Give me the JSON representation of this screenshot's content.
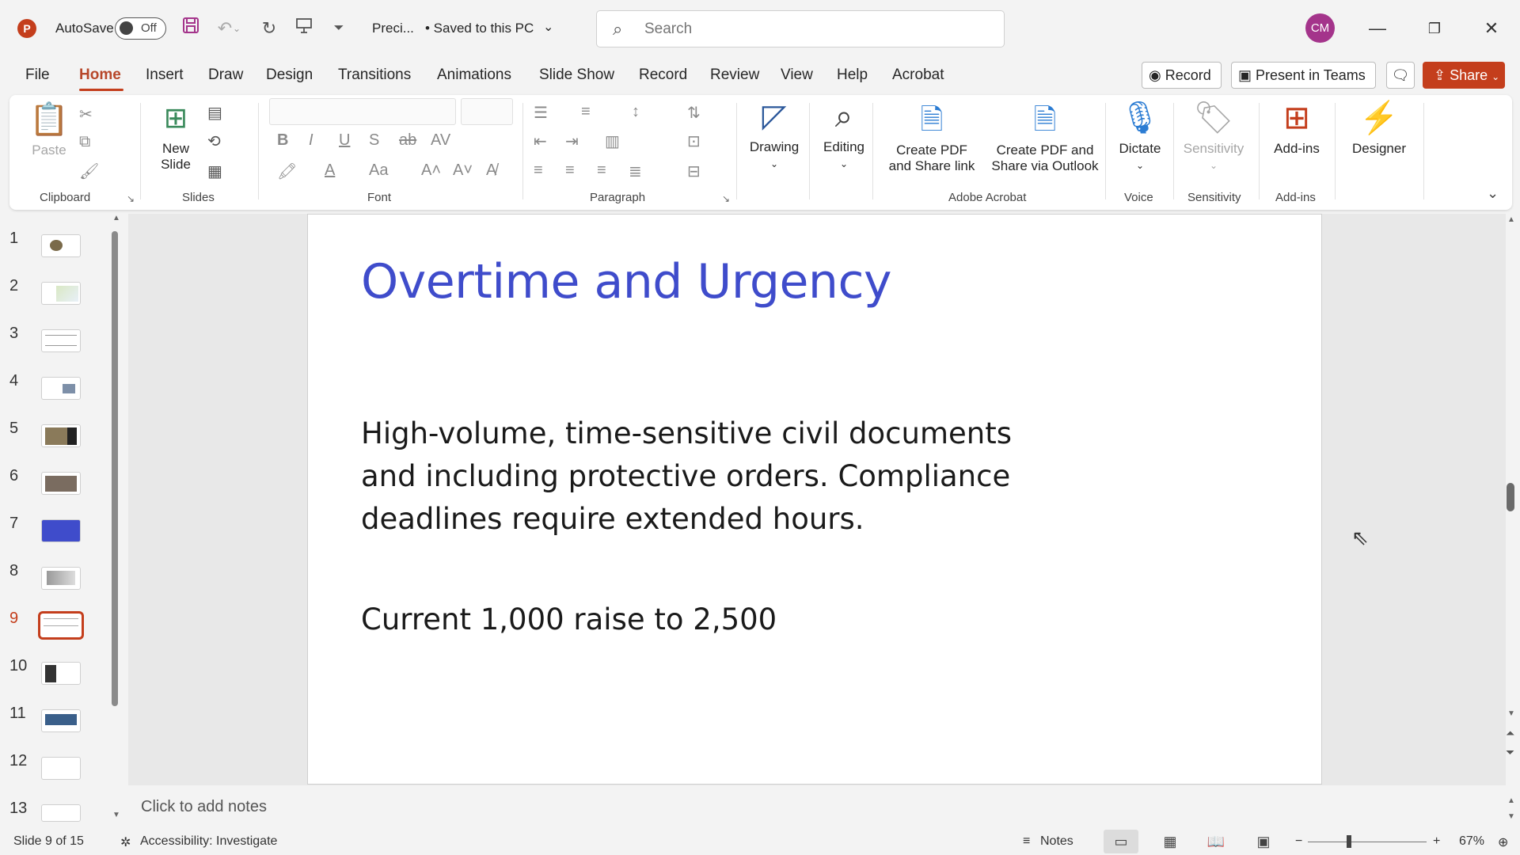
{
  "titlebar": {
    "app_logo": "P",
    "autosave_label": "AutoSave",
    "autosave_state": "Off",
    "doc_title": "Preci...",
    "doc_status": "• Saved to this PC",
    "search_placeholder": "Search",
    "avatar_initials": "CM"
  },
  "tabs": [
    "File",
    "Home",
    "Insert",
    "Draw",
    "Design",
    "Transitions",
    "Animations",
    "Slide Show",
    "Record",
    "Review",
    "View",
    "Help",
    "Acrobat"
  ],
  "active_tab": "Home",
  "top_actions": {
    "record": "Record",
    "present_teams": "Present in Teams",
    "share": "Share"
  },
  "ribbon": {
    "clipboard": {
      "paste": "Paste",
      "label": "Clipboard"
    },
    "slides": {
      "new_slide_1": "New",
      "new_slide_2": "Slide",
      "label": "Slides"
    },
    "font": {
      "label": "Font"
    },
    "paragraph": {
      "label": "Paragraph"
    },
    "drawing": "Drawing",
    "editing": "Editing",
    "acrobat": {
      "create_pdf_1": "Create PDF",
      "create_pdf_2": "and Share link",
      "create_pdf_outlook_1": "Create PDF and",
      "create_pdf_outlook_2": "Share via Outlook",
      "label": "Adobe Acrobat"
    },
    "voice": {
      "dictate": "Dictate",
      "label": "Voice"
    },
    "sensitivity": {
      "button": "Sensitivity",
      "label": "Sensitivity"
    },
    "addins": {
      "button": "Add-ins",
      "label": "Add-ins"
    },
    "designer": "Designer"
  },
  "thumbnails": {
    "numbers": [
      "1",
      "2",
      "3",
      "4",
      "5",
      "6",
      "7",
      "8",
      "9",
      "10",
      "11",
      "12",
      "13"
    ],
    "active": "9"
  },
  "slide": {
    "title": "Overtime and Urgency",
    "body": "High-volume, time-sensitive civil documents and including protective orders. Compliance deadlines require extended hours.",
    "body2": "Current 1,000 raise to 2,500"
  },
  "notes_placeholder": "Click to add notes",
  "statusbar": {
    "slide_counter": "Slide 9 of 15",
    "accessibility": "Accessibility: Investigate",
    "notes": "Notes",
    "zoom": "67%"
  },
  "colors": {
    "accent": "#c43e1c",
    "title": "#3f4ccb"
  }
}
